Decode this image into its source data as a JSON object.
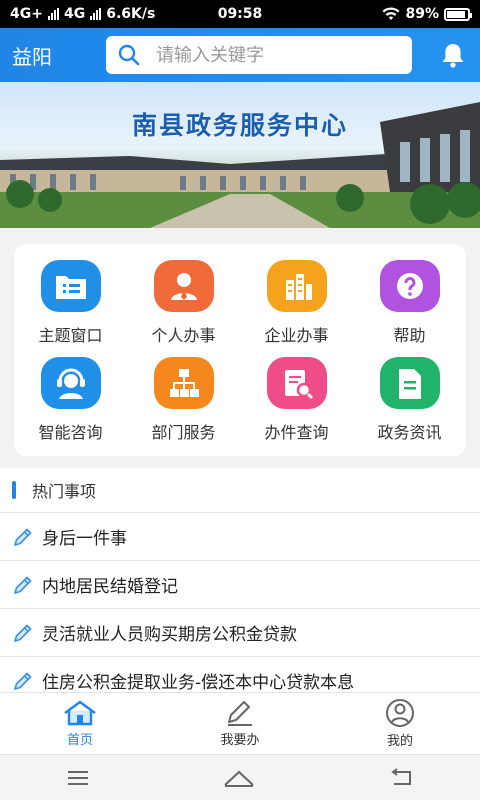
{
  "status_bar": {
    "network": "4G+",
    "network2": "4G",
    "speed": "6.6K/s",
    "time": "09:58",
    "battery": "89%",
    "battery_level": 0.89
  },
  "header": {
    "city": "益阳",
    "search_placeholder": "请输入关键字",
    "bell_icon": "bell-icon"
  },
  "banner": {
    "title": "南县政务服务中心"
  },
  "services": [
    {
      "label": "主题窗口",
      "icon": "folder-list-icon",
      "color": "#1f8fe8"
    },
    {
      "label": "个人办事",
      "icon": "person-icon",
      "color": "#f06a3a"
    },
    {
      "label": "企业办事",
      "icon": "building-icon",
      "color": "#f5a21d"
    },
    {
      "label": "帮助",
      "icon": "help-icon",
      "color": "#b252e0"
    },
    {
      "label": "智能咨询",
      "icon": "headset-icon",
      "color": "#1f8fe8"
    },
    {
      "label": "部门服务",
      "icon": "org-chart-icon",
      "color": "#f5871f"
    },
    {
      "label": "办件查询",
      "icon": "search-document-icon",
      "color": "#ee4d8a"
    },
    {
      "label": "政务资讯",
      "icon": "document-icon",
      "color": "#22b36a"
    }
  ],
  "hot": {
    "title": "热门事项",
    "items": [
      {
        "label": "身后一件事"
      },
      {
        "label": "内地居民结婚登记"
      },
      {
        "label": "灵活就业人员购买期房公积金贷款"
      },
      {
        "label": "住房公积金提取业务-偿还本中心贷款本息"
      }
    ]
  },
  "tabs": [
    {
      "label": "首页",
      "icon": "home-icon",
      "active": true
    },
    {
      "label": "我要办",
      "icon": "pen-icon",
      "active": false
    },
    {
      "label": "我的",
      "icon": "user-icon",
      "active": false
    }
  ],
  "colors": {
    "accent": "#1f86e8",
    "background": "#f2f2f2"
  }
}
